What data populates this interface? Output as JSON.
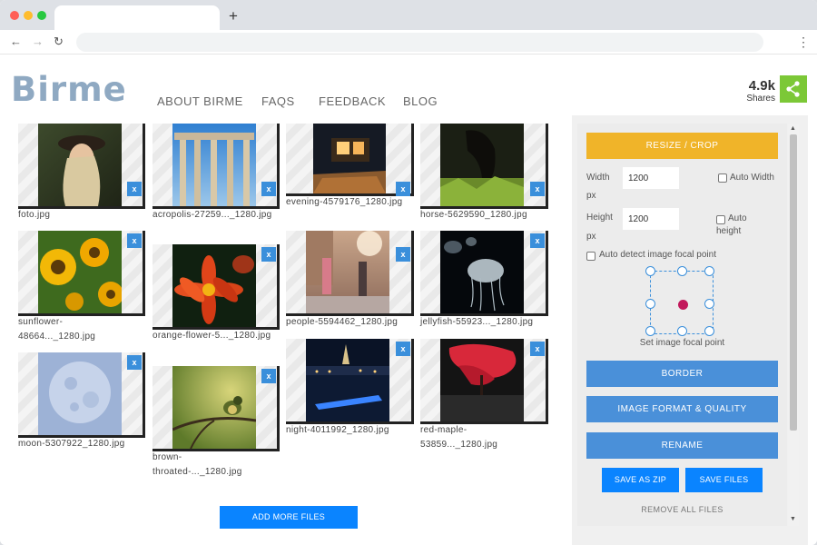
{
  "browser": {
    "new_tab_icon": "plus-icon",
    "back_icon": "arrow-left-icon",
    "forward_icon": "arrow-right-icon",
    "reload_icon": "reload-icon",
    "menu_icon": "kebab-menu-icon"
  },
  "header": {
    "logo": "Birme",
    "nav": [
      "ABOUT BIRME",
      "FAQS",
      "FEEDBACK",
      "BLOG"
    ],
    "shares_count": "4.9k",
    "shares_label": "Shares",
    "share_color": "#7cc837"
  },
  "gallery": {
    "remove_label": "x",
    "files": [
      {
        "name": "foto.jpg"
      },
      {
        "name": "acropolis-27259..._1280.jpg"
      },
      {
        "name": "evening-4579176_1280.jpg"
      },
      {
        "name": "horse-5629590_1280.jpg"
      },
      {
        "name": "sunflower-48664..._1280.jpg"
      },
      {
        "name": "orange-flower-5..._1280.jpg"
      },
      {
        "name": "people-5594462_1280.jpg"
      },
      {
        "name": "jellyfish-55923..._1280.jpg"
      },
      {
        "name": "moon-5307922_1280.jpg"
      },
      {
        "name": "brown-throated-..._1280.jpg"
      },
      {
        "name": "night-4011992_1280.jpg"
      },
      {
        "name": "red-maple-53859..._1280.jpg"
      }
    ],
    "add_more_label": "ADD MORE FILES"
  },
  "panel": {
    "resize_crop_label": "RESIZE / CROP",
    "width_label": "Width",
    "width_unit": "px",
    "width_value": "1200",
    "auto_width_label": "Auto Width",
    "height_label": "Height",
    "height_unit": "px",
    "height_value": "1200",
    "auto_height_label": "Auto height",
    "auto_detect_label": "Auto detect image focal point",
    "focal_label": "Set image focal point",
    "border_label": "BORDER",
    "format_label": "IMAGE FORMAT & QUALITY",
    "rename_label": "RENAME",
    "save_zip_label": "SAVE AS ZIP",
    "save_files_label": "SAVE FILES",
    "remove_all_label": "REMOVE ALL FILES",
    "accent_orange": "#f0b429",
    "accent_blue": "#4a90d9"
  }
}
